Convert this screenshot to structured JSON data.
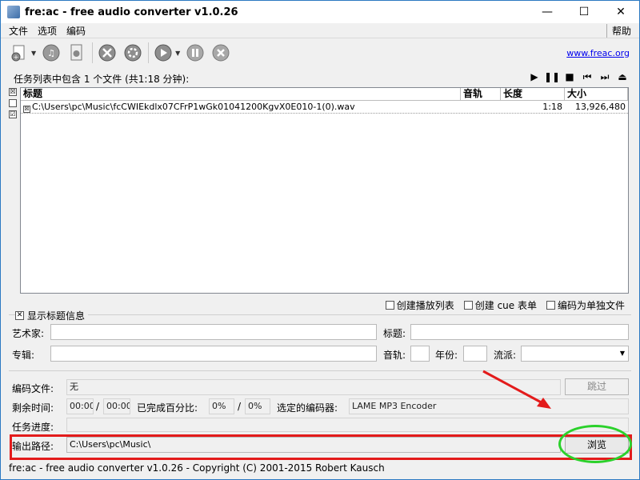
{
  "window": {
    "title": "fre:ac - free audio converter v1.0.26",
    "controls": {
      "minimize": "—",
      "maximize": "☐",
      "close": "✕"
    }
  },
  "menu": {
    "items": [
      "文件",
      "选项",
      "编码"
    ],
    "help": "帮助"
  },
  "toolbar": {
    "icons": [
      "add-files-icon",
      "add-cd-icon",
      "add-file-icon",
      "settings-icon",
      "config-icon",
      "play-encode-icon",
      "pause-icon",
      "stop-icon"
    ],
    "website": "www.freac.org"
  },
  "joblist": {
    "summary": "任务列表中包含 1 个文件 (共1:18 分钟):",
    "player_icons": [
      "play-icon",
      "pause-icon",
      "stop-icon",
      "previous-icon",
      "next-icon",
      "eject-icon"
    ],
    "headers": {
      "title": "标题",
      "track": "音轨",
      "length": "长度",
      "size": "大小"
    },
    "rows": [
      {
        "checked": "☒",
        "title": "C:\\Users\\pc\\Music\\fcCWIEkdlx07CFrP1wGk01041200KgvX0E010-1(0).wav",
        "track": "",
        "length": "1:18",
        "size": "13,926,480"
      }
    ],
    "side_checks": [
      "☒",
      "",
      "☑"
    ]
  },
  "options": {
    "playlist": "创建播放列表",
    "cue": "创建 cue 表单",
    "single": "编码为单独文件"
  },
  "tag_section": {
    "toggle_mark": "✕",
    "label": "显示标题信息",
    "artist_label": "艺术家:",
    "title_label": "标题:",
    "album_label": "专辑:",
    "track_label": "音轨:",
    "year_label": "年份:",
    "genre_label": "流派:",
    "artist": "",
    "title": "",
    "album": "",
    "track": "",
    "year": "",
    "genre": ""
  },
  "status": {
    "encoding_label": "编码文件:",
    "encoding_value": "无",
    "skip_label": "跳过",
    "remaining_label": "剩余时间:",
    "time1": "00:00",
    "slash": "/",
    "time2": "00:00",
    "percent_label": "已完成百分比:",
    "pct1": "0%",
    "pct2": "0%",
    "encoder_label": "选定的编码器:",
    "encoder_value": "LAME MP3 Encoder",
    "progress_label": "任务进度:",
    "progress": 0,
    "output_label": "输出路径:",
    "output_value": "C:\\Users\\pc\\Music\\",
    "browse_label": "浏览"
  },
  "statusbar": "fre:ac - free audio converter v1.0.26 - Copyright (C) 2001-2015 Robert Kausch",
  "colors": {
    "highlight_box": "#e31b1b",
    "highlight_ellipse": "#2bd12b",
    "arrow": "#e31b1b",
    "link": "#0000ee"
  }
}
